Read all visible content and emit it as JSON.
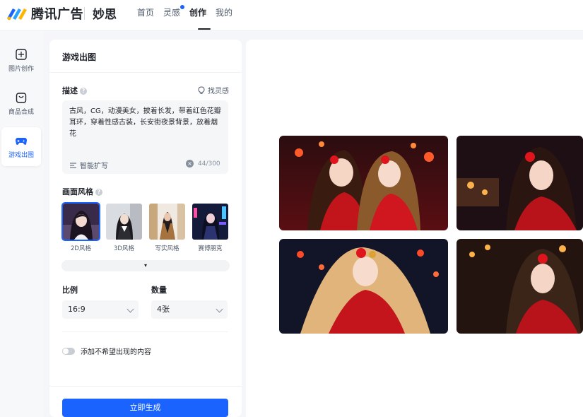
{
  "header": {
    "brand": "腾讯广告",
    "product": "妙思",
    "nav": [
      {
        "label": "首页",
        "active": false,
        "dot": false
      },
      {
        "label": "灵感",
        "active": false,
        "dot": true
      },
      {
        "label": "创作",
        "active": true,
        "dot": false
      },
      {
        "label": "我的",
        "active": false,
        "dot": false
      }
    ],
    "accent": "#1b63ff"
  },
  "rail": {
    "items": [
      {
        "label": "图片创作",
        "icon": "image-create-icon",
        "active": false
      },
      {
        "label": "商品合成",
        "icon": "shopping-bag-icon",
        "active": false
      },
      {
        "label": "游戏出图",
        "icon": "gamepad-icon",
        "active": true
      }
    ]
  },
  "panel": {
    "title": "游戏出图",
    "description": {
      "label": "描述",
      "inspire": "找灵感",
      "prompt": "古风，CG，动漫美女，披着长发，带着红色花瓣耳环，穿着性感古装，长安街夜景背景，放着烟花",
      "expand": "智能扩写",
      "count": "44/300"
    },
    "style": {
      "label": "画面风格",
      "options": [
        {
          "name": "2D风格",
          "selected": true
        },
        {
          "name": "3D风格",
          "selected": false
        },
        {
          "name": "写实风格",
          "selected": false
        },
        {
          "name": "赛博朋克",
          "selected": false
        }
      ],
      "more_icon": "▾"
    },
    "ratio": {
      "label": "比例",
      "value": "16:9"
    },
    "quantity": {
      "label": "数量",
      "value": "4张"
    },
    "negative": {
      "label": "添加不希望出现的内容",
      "enabled": false
    },
    "generate": "立即生成"
  }
}
